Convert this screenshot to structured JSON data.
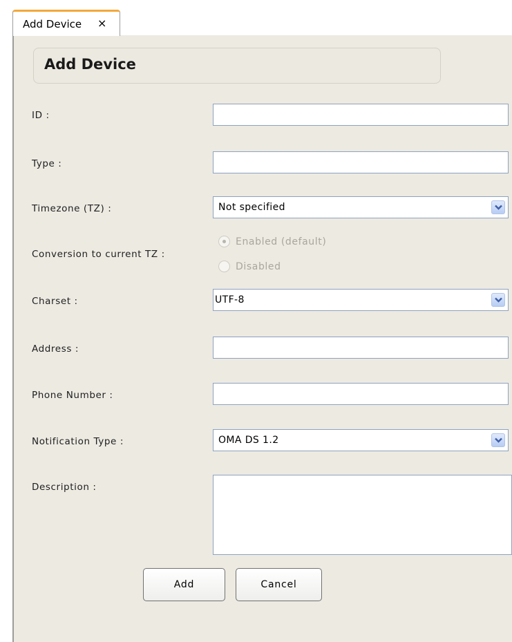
{
  "tab": {
    "label": "Add Device",
    "close": "×"
  },
  "form": {
    "title": "Add Device",
    "id_label": "ID :",
    "id_value": "",
    "type_label": "Type :",
    "type_value": "",
    "timezone_label": "Timezone (TZ) :",
    "timezone_value": "Not specified",
    "conversion_label": "Conversion to current TZ :",
    "conversion_options": [
      {
        "label": "Enabled (default)",
        "checked": true,
        "disabled": true
      },
      {
        "label": "Disabled",
        "checked": false,
        "disabled": true
      }
    ],
    "charset_label": "Charset :",
    "charset_value": "UTF-8",
    "address_label": "Address :",
    "address_value": "",
    "phone_label": "Phone Number :",
    "phone_value": "",
    "notification_label": "Notification Type :",
    "notification_value": "OMA DS 1.2",
    "description_label": "Description :",
    "description_value": ""
  },
  "buttons": {
    "add": "Add",
    "cancel": "Cancel"
  },
  "colors": {
    "tab_accent": "#f3a73a",
    "panel_bg": "#edeae2",
    "field_border": "#8da2bf",
    "select_arrow": "#3d5fa6"
  }
}
